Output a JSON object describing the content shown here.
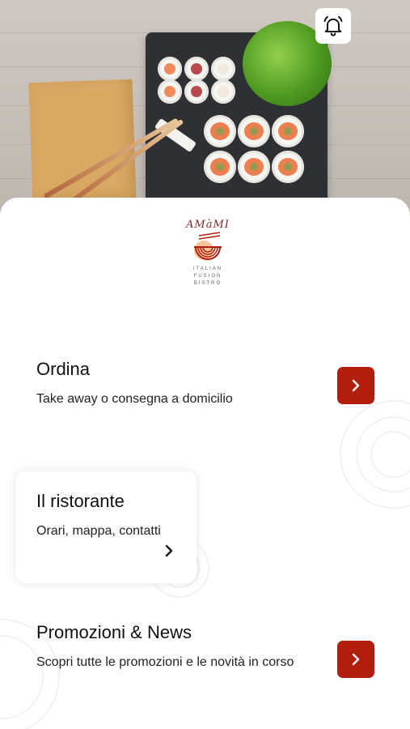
{
  "brand": {
    "name": "AMàMI",
    "tagline": [
      "ITALIAN",
      "FUSION",
      "BISTRÒ"
    ],
    "accent_color": "#b11e0e"
  },
  "header": {
    "notification_icon": "bell-icon"
  },
  "menu": {
    "order": {
      "title": "Ordina",
      "subtitle": "Take away o consegna a domicilio",
      "icon": "chevron-right-icon"
    },
    "restaurant": {
      "title": "Il ristorante",
      "subtitle": "Orari, mappa, contatti",
      "icon": "chevron-right-icon"
    },
    "promotions": {
      "title": "Promozioni & News",
      "subtitle": "Scopri tutte le promozioni e le novità in corso",
      "icon": "chevron-right-icon"
    }
  }
}
